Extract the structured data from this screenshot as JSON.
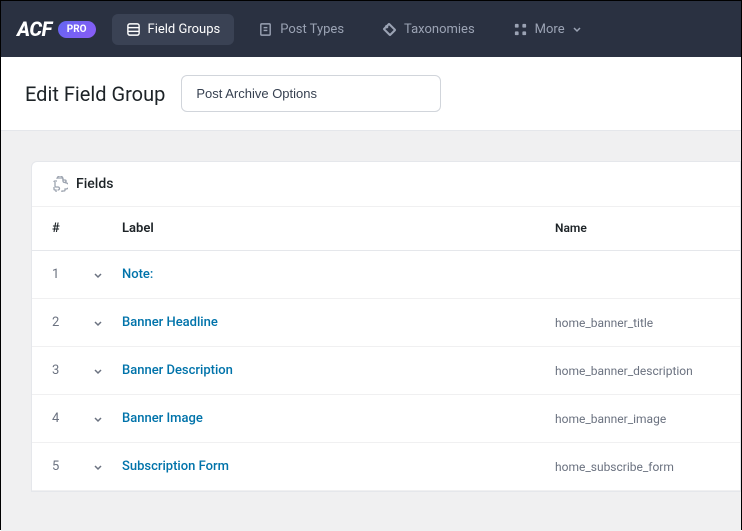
{
  "logo_text": "ACF",
  "pro_badge": "PRO",
  "nav": {
    "field_groups": "Field Groups",
    "post_types": "Post Types",
    "taxonomies": "Taxonomies",
    "more": "More"
  },
  "page_title": "Edit Field Group",
  "title_input_value": "Post Archive Options",
  "panel": {
    "title": "Fields",
    "columns": {
      "num": "#",
      "label": "Label",
      "name": "Name"
    },
    "rows": [
      {
        "num": "1",
        "label": "Note:",
        "name": ""
      },
      {
        "num": "2",
        "label": "Banner Headline",
        "name": "home_banner_title"
      },
      {
        "num": "3",
        "label": "Banner Description",
        "name": "home_banner_description"
      },
      {
        "num": "4",
        "label": "Banner Image",
        "name": "home_banner_image"
      },
      {
        "num": "5",
        "label": "Subscription Form",
        "name": "home_subscribe_form"
      }
    ]
  }
}
